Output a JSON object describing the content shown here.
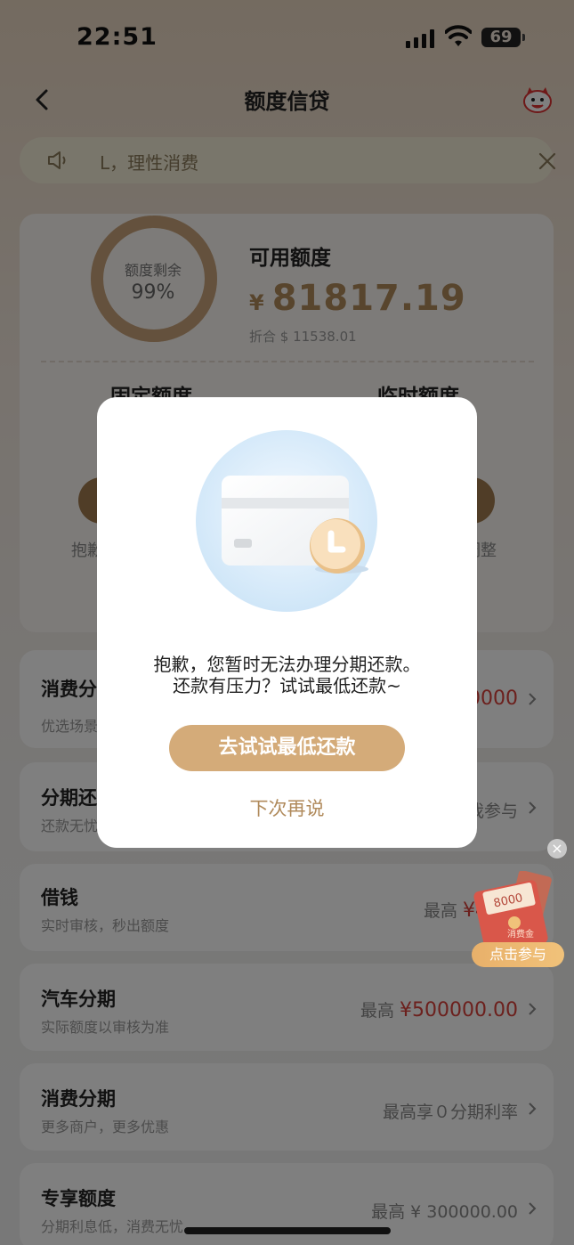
{
  "status_bar": {
    "time": "22:51",
    "battery": "69"
  },
  "nav": {
    "title": "额度信贷"
  },
  "notice": {
    "text": "L，理性消费"
  },
  "credit": {
    "ring_label": "额度剩余",
    "ring_value": "99%",
    "ring_fraction": 0.99,
    "available_label": "可用额度",
    "currency": "¥",
    "available_amount": "81817.19",
    "converted": "折合 $ 11538.01",
    "fixed_label": "固定额度",
    "temp_label": "临时额度",
    "left_caption": "抱歉",
    "right_caption": "调整"
  },
  "rows": [
    {
      "title": "消费分",
      "subtitle": "优选场景",
      "right_red": "0000",
      "right_text": ""
    },
    {
      "title": "分期还",
      "subtitle": "还款无忧",
      "right_text": "我参与",
      "right_red": ""
    },
    {
      "title": "借钱",
      "subtitle": "实时审核，秒出额度",
      "right_text": "最高",
      "right_red": "¥41"
    },
    {
      "title": "汽车分期",
      "subtitle": "实际额度以审核为准",
      "right_text": "最高",
      "right_red": "¥500000.00"
    },
    {
      "title": "消费分期",
      "subtitle": "更多商户，更多优惠",
      "right_text": "最高享０分期利率",
      "right_red": ""
    },
    {
      "title": "专享额度",
      "subtitle": "分期利息低，消费无忧",
      "right_text": "最高 ¥ 300000.00",
      "right_red": ""
    }
  ],
  "float_promo": {
    "amount": "8000",
    "tag": "消费金",
    "button": "点击参与",
    "close": "×"
  },
  "dialog": {
    "line1": "抱歉，您暂时无法办理分期还款。",
    "line2": "还款有压力？试试最低还款~",
    "primary_button": "去试试最低还款",
    "secondary_link": "下次再说"
  },
  "colors": {
    "accent": "#d4ab79",
    "brand_brown": "#b08a5b",
    "price_red": "#d9413a"
  }
}
